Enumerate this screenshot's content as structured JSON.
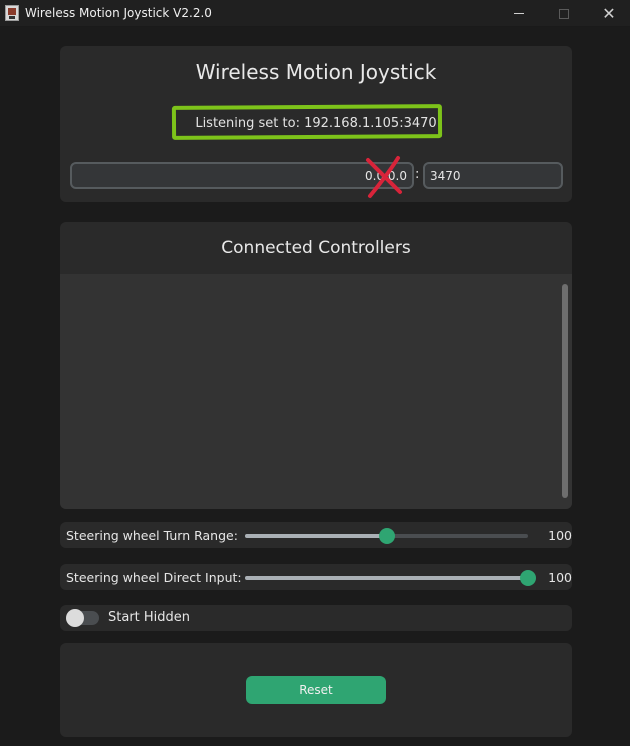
{
  "window": {
    "title": "Wireless Motion Joystick V2.2.0",
    "controls": {
      "minimize": "minimize-icon",
      "maximize": "maximize-icon",
      "close": "close-icon"
    },
    "close_glyph": "✕"
  },
  "header": {
    "title": "Wireless Motion Joystick",
    "listening_text": "Listening set to: 192.168.1.105:3470"
  },
  "connection": {
    "ip_value": "0.0.0.0",
    "separator": ":",
    "port_value": "3470"
  },
  "annotations": {
    "highlight_color": "#7dc31a",
    "cross_color": "#d8243a"
  },
  "controllers": {
    "title": "Connected Controllers",
    "items": []
  },
  "settings": {
    "turn_range": {
      "label": "Steering wheel Turn Range:",
      "value": "100",
      "level_fraction": 0.5
    },
    "direct_input": {
      "label": "Steering wheel Direct Input:",
      "value": "100",
      "level_fraction": 1.0
    },
    "start_hidden": {
      "label": "Start Hidden",
      "enabled": false
    }
  },
  "actions": {
    "reset_label": "Reset"
  },
  "colors": {
    "accent": "#2fa572",
    "background": "#1b1b1b",
    "card": "#2a2a2a"
  }
}
